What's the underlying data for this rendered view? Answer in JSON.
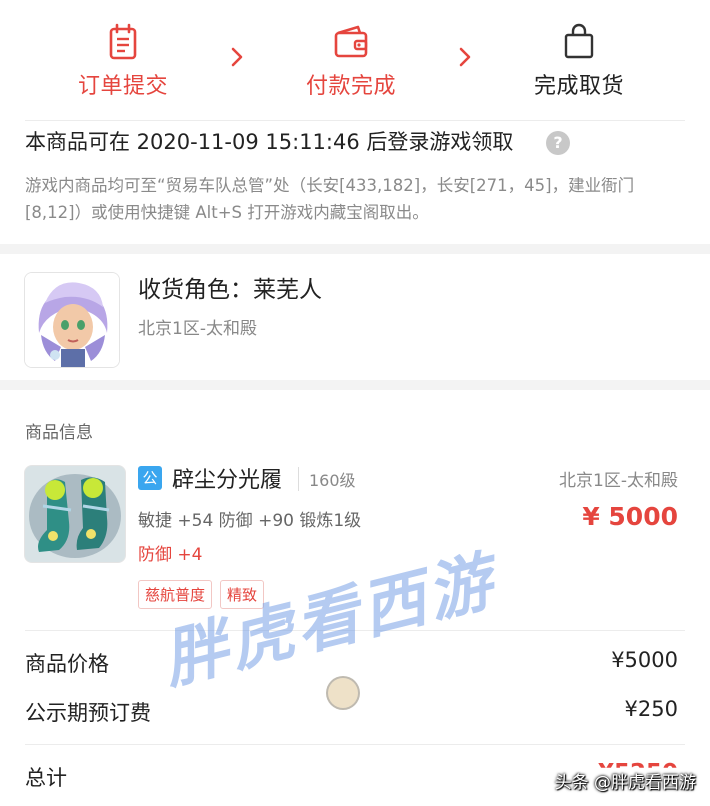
{
  "steps": [
    {
      "label": "订单提交",
      "icon": "clipboard-icon",
      "state": "done"
    },
    {
      "label": "付款完成",
      "icon": "wallet-icon",
      "state": "done"
    },
    {
      "label": "完成取货",
      "icon": "bag-icon",
      "state": "pending"
    }
  ],
  "colors": {
    "accent": "#e5453e",
    "muted": "#888888",
    "badge": "#3aa6ef"
  },
  "notice": {
    "title": "本商品可在 2020-11-09 15:11:46 后登录游戏领取",
    "help_icon": "?",
    "desc": "游戏内商品均可至“贸易车队总管”处（长安[433,182]，长安[271，45]，建业衙门[8,12]）或使用快捷键 Alt+S 打开游戏内藏宝阁取出。"
  },
  "receiver": {
    "title": "收货角色：莱芜人",
    "server": "北京1区-太和殿"
  },
  "goods": {
    "section_label": "商品信息",
    "badge": "公",
    "name": "辟尘分光履",
    "level": "160级",
    "server": "北京1区-太和殿",
    "attributes": "敏捷 +54 防御 +90 锻炼1级",
    "price": "¥ 5000",
    "extra": "防御 +4",
    "tags": [
      "慈航普度",
      "精致"
    ]
  },
  "summary": {
    "price_label": "商品价格",
    "price_value": "¥5000",
    "fee_label": "公示期预订费",
    "fee_value": "¥250",
    "total_label": "总计",
    "total_value": "¥5250"
  },
  "watermark": {
    "main": "胖虎看西游",
    "corner": "头条 @胖虎看西游"
  }
}
